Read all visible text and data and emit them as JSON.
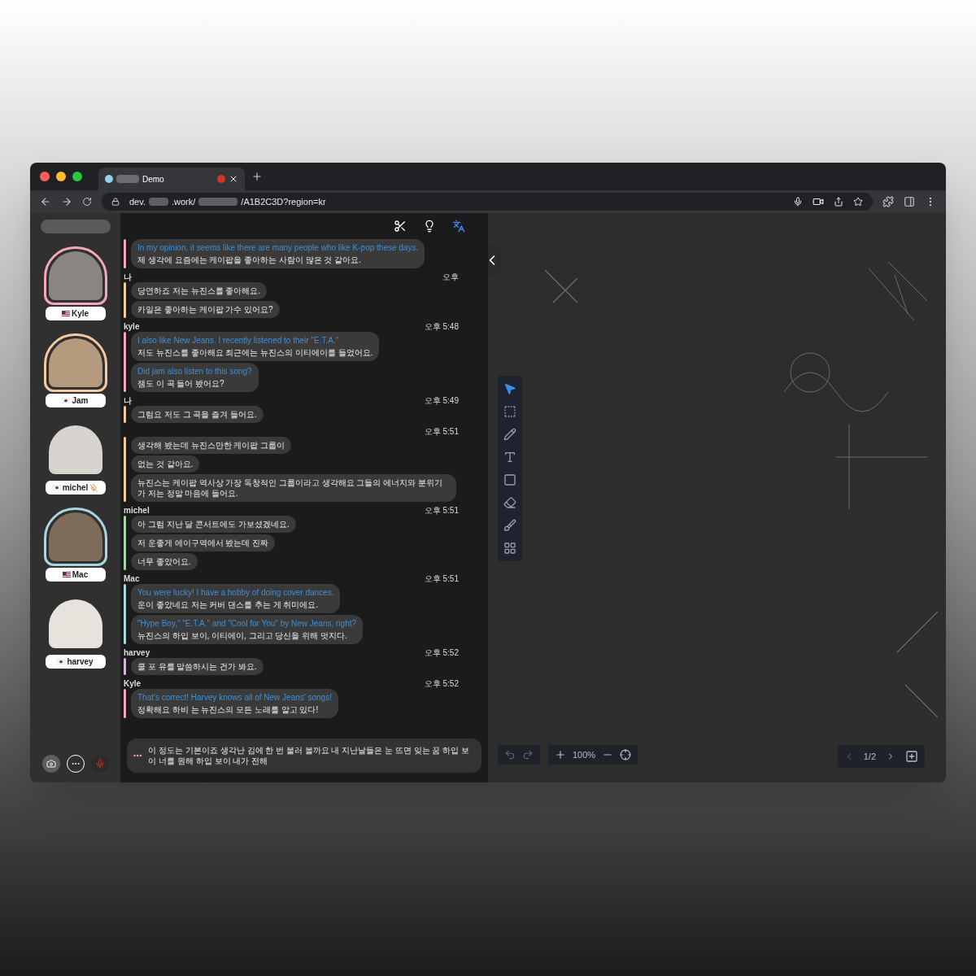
{
  "browser": {
    "tab": {
      "title": "Demo"
    },
    "url": {
      "start": "dev.",
      "middle": ".work/",
      "end": "/A1B2C3D?region=kr"
    }
  },
  "participants": [
    {
      "name": "Kyle",
      "kind": "us",
      "color": "#f4a7b9",
      "muted": false
    },
    {
      "name": "Jam",
      "kind": "kr",
      "color": "#f5c9a0",
      "muted": false
    },
    {
      "name": "michel",
      "kind": "kr",
      "muted": true
    },
    {
      "name": "Mac",
      "kind": "us",
      "color": "#a9d6df",
      "muted": false
    },
    {
      "name": "harvey",
      "kind": "kr",
      "muted": false
    }
  ],
  "chat": {
    "groups": [
      {
        "color": "#f4a7b9",
        "messages": [
          {
            "translation": "In my opinion, it seems like there are many people who like K-pop these days.",
            "text": "제 생각에 요즘에는 케이팝을 좋아하는 사람이 많은 것 같아요."
          }
        ]
      },
      {
        "sender": "나",
        "time": "오후",
        "color": "#f5c9a0",
        "messages": [
          {
            "text": "당연하죠 저는 뉴진스를 좋아해요."
          },
          {
            "text": "카일은 좋아하는 케이팝 가수 있어요?"
          }
        ]
      },
      {
        "sender": "kyle",
        "time": "오후 5:48",
        "color": "#f4a7b9",
        "messages": [
          {
            "translation": "I also like New Jeans. I recently listened to their \"E.T.A.\"",
            "text": "저도 뉴진스를 좋아해요 최근에는 뉴진스의 이티에이를 들었어요."
          },
          {
            "translation": "Did jam also listen to this song?",
            "text": "잼도 이 곡 들어 봤어요?"
          }
        ]
      },
      {
        "sender": "나",
        "time": "오후 5:49",
        "color": "#f5c9a0",
        "messages": [
          {
            "text": "그럼요 저도 그 곡을 즐겨 들어요."
          }
        ]
      },
      {
        "time": "오후 5:51",
        "color": "#f5c9a0",
        "messages": [
          {
            "text": "생각해 봤는데 뉴진스만한 케이팝 그룹이"
          },
          {
            "text": "없는 것 같아요."
          },
          {
            "text": "뉴진스는 케이팝 역사상 가장 독창적인 그룹이라고 생각해요 그들의 에너지와 분위기가 저는 정말 마음에 들어요."
          }
        ]
      },
      {
        "sender": "michel",
        "time": "오후 5:51",
        "color": "#a5d6a7",
        "messages": [
          {
            "text": "아 그럼 지난 달 콘서트에도 가보셨겠네요."
          },
          {
            "text": "저 운좋게 에이구역에서 봤는데 진짜"
          },
          {
            "text": "너무 좋았어요."
          }
        ]
      },
      {
        "sender": "Mac",
        "time": "오후 5:51",
        "color": "#a9d6df",
        "messages": [
          {
            "translation": "You were lucky! I have a hobby of doing cover dances.",
            "text": "운이 좋았네요 저는 커버 댄스를 추는 게 취미에요."
          },
          {
            "translation": "\"Hype Boy,\" \"E.T.A.\" and \"Cool for You\" by New Jeans, right?",
            "text": "뉴진스의 하입 보이, 이티에이, 그리고 당신을 위해 멋지다."
          }
        ]
      },
      {
        "sender": "harvey",
        "time": "오후 5:52",
        "color": "#d8b4d8",
        "messages": [
          {
            "text": "쿨 포 유를 말씀하시는 건가 봐요."
          }
        ]
      },
      {
        "sender": "Kyle",
        "time": "오후 5:52",
        "color": "#f4a7b9",
        "messages": [
          {
            "translation": "That's correct! Harvey knows all of New Jeans' songs!",
            "text": "정확해요 하비 는 뉴진스의 모든 노래를 알고 있다!"
          }
        ]
      }
    ],
    "typing": {
      "text": "이 정도는 기본이죠 생각난 김에 한 번 불러 볼까요 내 지난날들은 눈 뜨면 잊는 꿈 하입 보이 너를 원해 하입 보이 내가 전해"
    }
  },
  "whiteboard": {
    "tools": [
      {
        "kind": "pointer",
        "selected": true
      },
      {
        "kind": "select",
        "selected": false
      },
      {
        "kind": "pencil",
        "selected": false
      },
      {
        "kind": "text",
        "selected": false
      },
      {
        "kind": "shape",
        "selected": false
      },
      {
        "kind": "eraser",
        "selected": false
      },
      {
        "kind": "clear",
        "selected": false
      },
      {
        "kind": "more",
        "selected": false
      }
    ],
    "zoom": "100%",
    "page": "1/2"
  }
}
